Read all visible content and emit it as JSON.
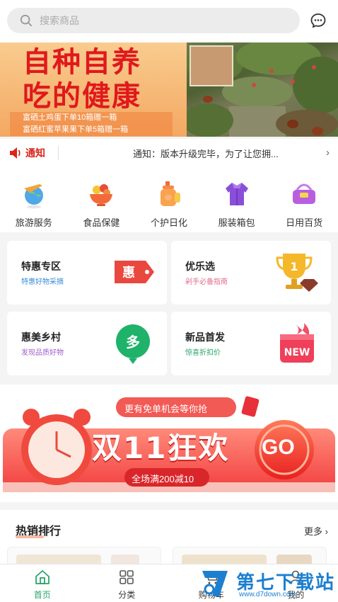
{
  "search": {
    "placeholder": "搜索商品"
  },
  "banner": {
    "title_line1": "自种自养",
    "title_line2": "吃的健康",
    "sub_line1": "富硒土鸡蛋下单10箱赠一箱",
    "sub_line2": "富硒红蜜苹果果下单5箱赠一箱"
  },
  "notice": {
    "tag": "通知",
    "text": "通知：版本升级完毕，为了让您拥...",
    "arrow": "›"
  },
  "categories": [
    {
      "label": "旅游服务",
      "icon": "globe-plane-icon"
    },
    {
      "label": "食品保健",
      "icon": "fruit-bowl-icon"
    },
    {
      "label": "个护日化",
      "icon": "lotion-bottle-icon"
    },
    {
      "label": "服装箱包",
      "icon": "jacket-icon"
    },
    {
      "label": "日用百货",
      "icon": "basket-icon"
    }
  ],
  "promos": [
    {
      "title": "特惠专区",
      "sub": "特惠好物采摘",
      "sub_color": "#3b8ed6",
      "art": "hui-tag-icon",
      "art_text": "惠"
    },
    {
      "title": "优乐选",
      "sub": "剁手必备指南",
      "sub_color": "#e26d8a",
      "art": "trophy-icon",
      "art_text": "1"
    },
    {
      "title": "惠美乡村",
      "sub": "发现品质好物",
      "sub_color": "#a060c8",
      "art": "green-badge-icon",
      "art_text": "多"
    },
    {
      "title": "新品首发",
      "sub": "惊喜折扣价",
      "sub_color": "#2aa56a",
      "art": "new-gift-icon",
      "art_text": "NEW"
    }
  ],
  "festival": {
    "top_pill": "更有免单机会等你抢",
    "headline": "双11狂欢",
    "deal": "全场满200减10",
    "go": "GO"
  },
  "hot": {
    "title": "热销排行",
    "more": "更多"
  },
  "tabs": [
    {
      "label": "首页",
      "icon": "home-icon",
      "active": true
    },
    {
      "label": "分类",
      "icon": "grid-icon",
      "active": false
    },
    {
      "label": "购物车",
      "icon": "cart-icon",
      "active": false
    },
    {
      "label": "我的",
      "icon": "user-icon",
      "active": false
    }
  ],
  "watermark": {
    "brand": "第七下载站",
    "url": "www.d7down.com"
  },
  "colors": {
    "accent": "#2aa56a",
    "red": "#e0191d"
  }
}
